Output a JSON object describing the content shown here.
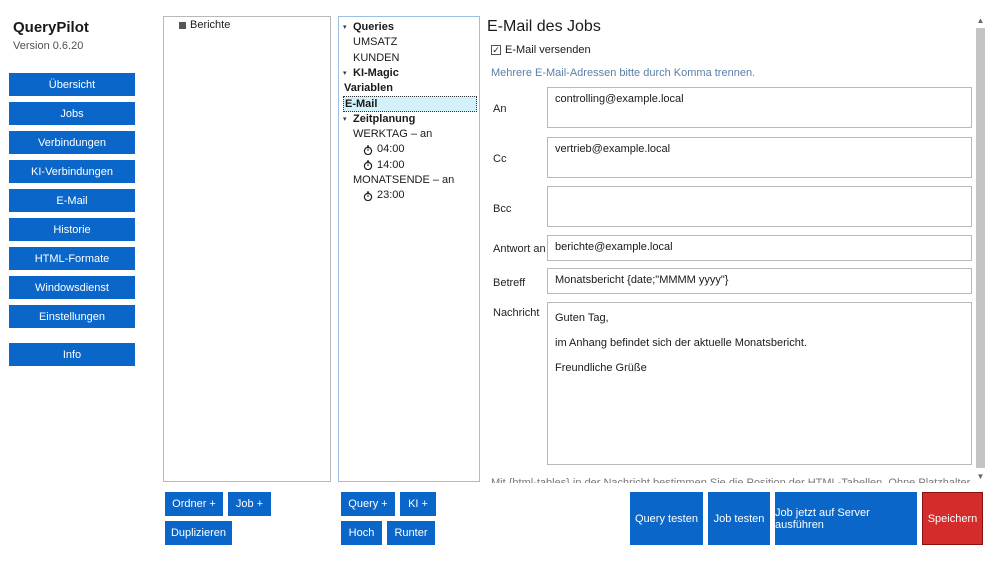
{
  "app": {
    "title": "QueryPilot",
    "version": "Version 0.6.20"
  },
  "nav": {
    "items": [
      {
        "label": "Übersicht"
      },
      {
        "label": "Jobs"
      },
      {
        "label": "Verbindungen"
      },
      {
        "label": "KI-Verbindungen"
      },
      {
        "label": "E-Mail"
      },
      {
        "label": "Historie"
      },
      {
        "label": "HTML-Formate"
      },
      {
        "label": "Windowsdienst"
      },
      {
        "label": "Einstellungen"
      }
    ],
    "info": "Info"
  },
  "folder_tree": {
    "root": "Berichte"
  },
  "job_tree": {
    "queries": {
      "label": "Queries",
      "children": [
        "UMSATZ",
        "KUNDEN"
      ]
    },
    "ki_magic": "KI-Magic",
    "variablen": "Variablen",
    "email": "E-Mail",
    "zeitplanung": {
      "label": "Zeitplanung",
      "werktag": "WERKTAG – an",
      "werktag_times": [
        "04:00",
        "14:00"
      ],
      "monatsende": "MONATSENDE – an",
      "monatsende_times": [
        "23:00"
      ]
    }
  },
  "buttons": {
    "ordner_add": "Ordner +",
    "job_add": "Job +",
    "duplizieren": "Duplizieren",
    "query_add": "Query +",
    "ki_add": "KI +",
    "hoch": "Hoch",
    "runter": "Runter",
    "query_testen": "Query testen",
    "job_testen": "Job testen",
    "job_server": "Job jetzt auf Server ausführen",
    "speichern": "Speichern"
  },
  "email_form": {
    "title": "E-Mail des Jobs",
    "send_checkbox_label": "E-Mail versenden",
    "send_checked": true,
    "hint": "Mehrere E-Mail-Adressen bitte durch Komma trennen.",
    "labels": {
      "an": "An",
      "cc": "Cc",
      "bcc": "Bcc",
      "antwort": "Antwort an",
      "betreff": "Betreff",
      "nachricht": "Nachricht"
    },
    "values": {
      "an": "controlling@example.local",
      "cc": "vertrieb@example.local",
      "bcc": "",
      "antwort": "berichte@example.local",
      "betreff": "Monatsbericht {date;\"MMMM yyyy\"}",
      "nachricht_lines": [
        "Guten Tag,",
        "im Anhang befindet sich der aktuelle Monatsbericht.",
        "Freundliche Grüße"
      ]
    },
    "footer_hint": "Mit {html-tables} in der Nachricht bestimmen Sie die Position der HTML-Tabellen. Ohne Platzhalter werden sie am"
  }
}
